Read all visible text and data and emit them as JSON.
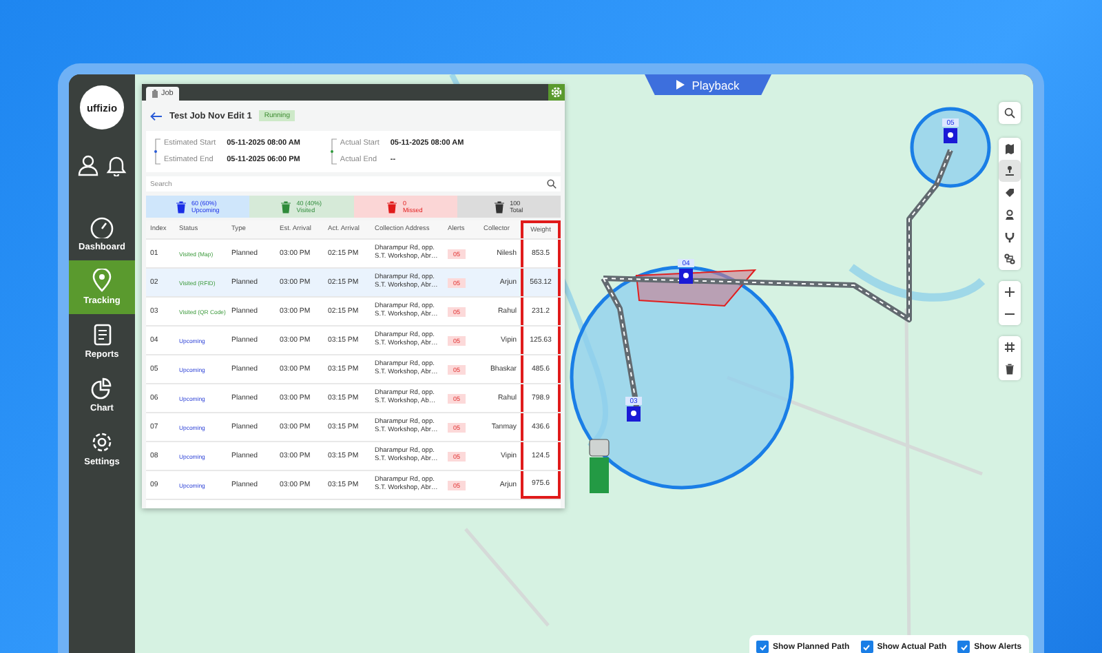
{
  "logo": {
    "text": "uffizio"
  },
  "sidebar": {
    "items": [
      {
        "label": "Dashboard",
        "selected": false
      },
      {
        "label": "Tracking",
        "selected": true
      },
      {
        "label": "Reports",
        "selected": false
      },
      {
        "label": "Chart",
        "selected": false
      },
      {
        "label": "Settings",
        "selected": false
      }
    ]
  },
  "playback": {
    "label": "Playback"
  },
  "job_panel": {
    "tab": "Job",
    "title": "Test Job Nov Edit 1",
    "status_badge": "Running",
    "dates": [
      {
        "label": "Estimated Start",
        "value": "05-11-2025 08:00 AM"
      },
      {
        "label": "Estimated End",
        "value": "05-11-2025 06:00 PM"
      },
      {
        "label": "Actual Start",
        "value": "05-11-2025 08:00 AM"
      },
      {
        "label": "Actual End",
        "value": "--"
      }
    ],
    "search": {
      "placeholder": "Search"
    },
    "stats": [
      {
        "kind": "upcoming",
        "value": "60 (60%)",
        "label": "Upcoming"
      },
      {
        "kind": "visited",
        "value": "40 (40%)",
        "label": "Visited"
      },
      {
        "kind": "missed",
        "value": "0",
        "label": "Missed"
      },
      {
        "kind": "total",
        "value": "100",
        "label": "Total"
      }
    ],
    "table": {
      "columns": [
        {
          "label": "Index",
          "highlighted": false
        },
        {
          "label": "Status",
          "highlighted": false
        },
        {
          "label": "Type",
          "highlighted": false
        },
        {
          "label": "Est. Arrival",
          "highlighted": false
        },
        {
          "label": "Act. Arrival",
          "highlighted": false
        },
        {
          "label": "Collection Address",
          "highlighted": false
        },
        {
          "label": "Alerts",
          "highlighted": false
        },
        {
          "label": "Collector",
          "highlighted": false
        },
        {
          "label": "Weight",
          "highlighted": true
        }
      ],
      "rows": [
        {
          "selected": false,
          "kind": "visited",
          "cells": [
            "01",
            "Visited (Map)",
            "Planned",
            "03:00 PM",
            "02:15 PM",
            "Dharampur Rd, opp. S.T. Workshop, Abr…",
            "05",
            "Nilesh",
            "853.5"
          ]
        },
        {
          "selected": true,
          "kind": "visited",
          "cells": [
            "02",
            "Visited (RFID)",
            "Planned",
            "03:00 PM",
            "02:15 PM",
            "Dharampur Rd, opp. S.T. Workshop, Abr…",
            "05",
            "Arjun",
            "563.12"
          ]
        },
        {
          "selected": false,
          "kind": "visited",
          "cells": [
            "03",
            "Visited (QR Code)",
            "Planned",
            "03:00 PM",
            "02:15 PM",
            "Dharampur Rd, opp. S.T. Workshop, Abr…",
            "05",
            "Rahul",
            "231.2"
          ]
        },
        {
          "selected": false,
          "kind": "upcoming",
          "cells": [
            "04",
            "Upcoming",
            "Planned",
            "03:00 PM",
            "03:15 PM",
            "Dharampur Rd, opp. S.T. Workshop, Abr…",
            "05",
            "Vipin",
            "125.63"
          ]
        },
        {
          "selected": false,
          "kind": "upcoming",
          "cells": [
            "05",
            "Upcoming",
            "Planned",
            "03:00 PM",
            "03:15 PM",
            "Dharampur Rd, opp. S.T. Workshop, Abr…",
            "05",
            "Bhaskar",
            "485.6"
          ]
        },
        {
          "selected": false,
          "kind": "upcoming",
          "cells": [
            "06",
            "Upcoming",
            "Planned",
            "03:00 PM",
            "03:15 PM",
            "Dharampur Rd, opp. S.T. Workshop, Ab…",
            "05",
            "Rahul",
            "798.9"
          ]
        },
        {
          "selected": false,
          "kind": "upcoming",
          "cells": [
            "07",
            "Upcoming",
            "Planned",
            "03:00 PM",
            "03:15 PM",
            "Dharampur Rd, opp. S.T. Workshop, Abr…",
            "05",
            "Tanmay",
            "436.6"
          ]
        },
        {
          "selected": false,
          "kind": "upcoming",
          "cells": [
            "08",
            "Upcoming",
            "Planned",
            "03:00 PM",
            "03:15 PM",
            "Dharampur Rd, opp. S.T. Workshop, Abr…",
            "05",
            "Vipin",
            "124.5"
          ]
        },
        {
          "selected": false,
          "kind": "upcoming",
          "cells": [
            "09",
            "Upcoming",
            "Planned",
            "03:00 PM",
            "03:15 PM",
            "Dharampur Rd, opp. S.T. Workshop, Abr…",
            "05",
            "Arjun",
            "975.6"
          ]
        }
      ]
    }
  },
  "map_markers": [
    "05",
    "04",
    "03"
  ],
  "map_options": [
    {
      "label": "Show Planned Path",
      "checked": true
    },
    {
      "label": "Show Actual Path",
      "checked": true
    },
    {
      "label": "Show Alerts",
      "checked": true
    }
  ]
}
